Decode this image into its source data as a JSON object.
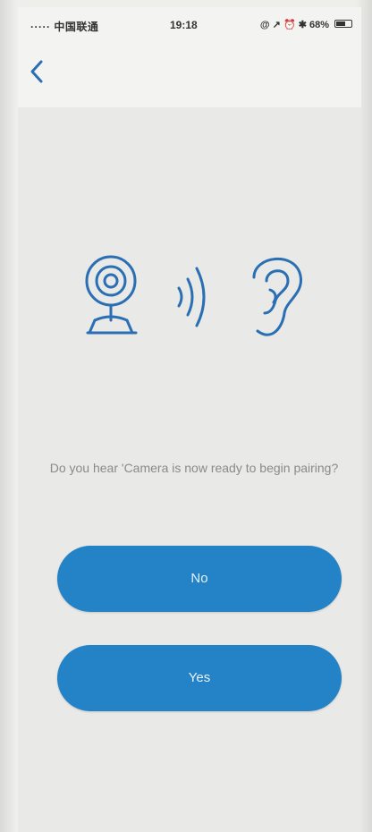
{
  "status_bar": {
    "carrier": "····· 中国联通",
    "time": "19:18",
    "right": "@ ↗ ⏰ ✱ 68%",
    "battery_level": 0.68
  },
  "nav": {
    "back_icon": "chevron-left-icon"
  },
  "illustration": {
    "icons": [
      "webcam-icon",
      "sound-waves-icon",
      "ear-icon"
    ],
    "color": "#2a6fb3"
  },
  "prompt": {
    "text": "Do you hear 'Camera is now ready to begin pairing?"
  },
  "buttons": {
    "no_label": "No",
    "yes_label": "Yes",
    "color": "#2383c6"
  }
}
